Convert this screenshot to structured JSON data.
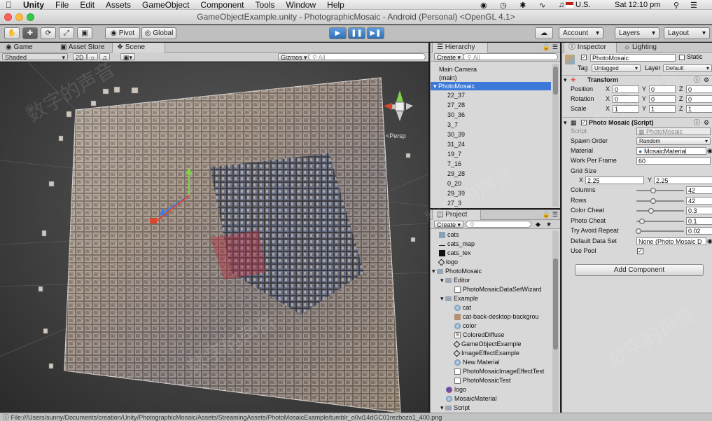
{
  "menubar": {
    "app": "Unity",
    "items": [
      "File",
      "Edit",
      "Assets",
      "GameObject",
      "Component",
      "Tools",
      "Window",
      "Help"
    ],
    "locale": "U.S.",
    "clock": "Sat 12:10 pm"
  },
  "window": {
    "title": "GameObjectExample.unity - PhotographicMosaic - Android (Personal) <OpenGL 4.1>"
  },
  "toolbar": {
    "pivot": "Pivot",
    "global": "Global",
    "account": "Account",
    "layers": "Layers",
    "layout": "Layout"
  },
  "scene": {
    "tabs": {
      "game": "Game",
      "asset_store": "Asset Store",
      "scene": "Scene"
    },
    "shading": "Shaded",
    "mode_2d": "2D",
    "gizmos": "Gizmos",
    "search_placeholder": "All",
    "persp": "Persp"
  },
  "hierarchy": {
    "title": "Hierarchy",
    "create": "Create",
    "search_placeholder": "All",
    "items": [
      "Main Camera",
      "(main)",
      "PhotoMosaic",
      "22_37",
      "27_28",
      "30_36",
      "3_7",
      "30_39",
      "31_24",
      "19_7",
      "7_16",
      "29_28",
      "0_20",
      "29_39",
      "27_3",
      "11_37"
    ]
  },
  "project": {
    "title": "Project",
    "create": "Create",
    "items": [
      {
        "label": "cats",
        "icon": "texture-icon"
      },
      {
        "label": "cats_map",
        "icon": "line-icon"
      },
      {
        "label": "cats_tex",
        "icon": "texture-icon"
      },
      {
        "label": "logo",
        "icon": "unity-scene-icon"
      },
      {
        "label": "PhotoMosaic",
        "icon": "folder-icon"
      },
      {
        "label": "Editor",
        "icon": "folder-icon"
      },
      {
        "label": "PhotoMosaicDataSetWizard",
        "icon": "script-icon"
      },
      {
        "label": "Example",
        "icon": "folder-icon"
      },
      {
        "label": "cat",
        "icon": "material-icon"
      },
      {
        "label": "cat-back-desktop-backgrou",
        "icon": "texture-icon"
      },
      {
        "label": "color",
        "icon": "material-icon"
      },
      {
        "label": "ColoredDiffuse",
        "icon": "shader-icon"
      },
      {
        "label": "GameObjectExample",
        "icon": "unity-scene-icon"
      },
      {
        "label": "ImageEffectExample",
        "icon": "unity-scene-icon"
      },
      {
        "label": "New Material",
        "icon": "material-icon"
      },
      {
        "label": "PhotoMosaicImageEffectTest",
        "icon": "script-icon"
      },
      {
        "label": "PhotoMosaicTest",
        "icon": "script-icon"
      },
      {
        "label": "logo",
        "icon": "asset-icon"
      },
      {
        "label": "MosaicMaterial",
        "icon": "material-icon"
      },
      {
        "label": "Script",
        "icon": "folder-icon"
      }
    ]
  },
  "inspector": {
    "tabs": {
      "inspector": "Inspector",
      "lighting": "Lighting"
    },
    "object_name": "PhotoMosaic",
    "static": "Static",
    "tag_label": "Tag",
    "tag": "Untagged",
    "layer_label": "Layer",
    "layer": "Default",
    "transform": {
      "title": "Transform",
      "rows": [
        {
          "label": "Position",
          "x": "0",
          "y": "0",
          "z": "0"
        },
        {
          "label": "Rotation",
          "x": "0",
          "y": "0",
          "z": "0"
        },
        {
          "label": "Scale",
          "x": "1",
          "y": "1",
          "z": "1"
        }
      ],
      "axis": {
        "x": "X",
        "y": "Y",
        "z": "Z"
      }
    },
    "script": {
      "title": "Photo Mosaic (Script)",
      "script_label": "Script",
      "script_value": "PhotoMosaic",
      "spawn_order_label": "Spawn Order",
      "spawn_order": "Random",
      "material_label": "Material",
      "material": "MosaicMaterial",
      "work_per_frame_label": "Work Per Frame",
      "work_per_frame": "60",
      "grid_size_label": "Grid Size",
      "grid_x": "2.25",
      "grid_y": "2.25",
      "sliders": [
        {
          "label": "Columns",
          "value": "42",
          "level": 0.35
        },
        {
          "label": "Rows",
          "value": "42",
          "level": 0.35
        },
        {
          "label": "Color Cheat",
          "value": "0.3",
          "level": 0.3
        },
        {
          "label": "Photo Cheat",
          "value": "0.1",
          "level": 0.1
        },
        {
          "label": "Try Avoid Repeat",
          "value": "0.02",
          "level": 0.02
        }
      ],
      "default_data_set_label": "Default Data Set",
      "default_data_set": "None (Photo Mosaic D",
      "use_pool_label": "Use Pool"
    },
    "add_component": "Add Component"
  },
  "statusbar": {
    "path": "File:///Users/sunny/Documents/creation/Unity/PhotographicMosaic/Assets/StreamingAssets/PhotoMosaicExample/tumblr_o0vi14dGC01rezbozo1_400.png"
  },
  "watermark": "数字的声音"
}
